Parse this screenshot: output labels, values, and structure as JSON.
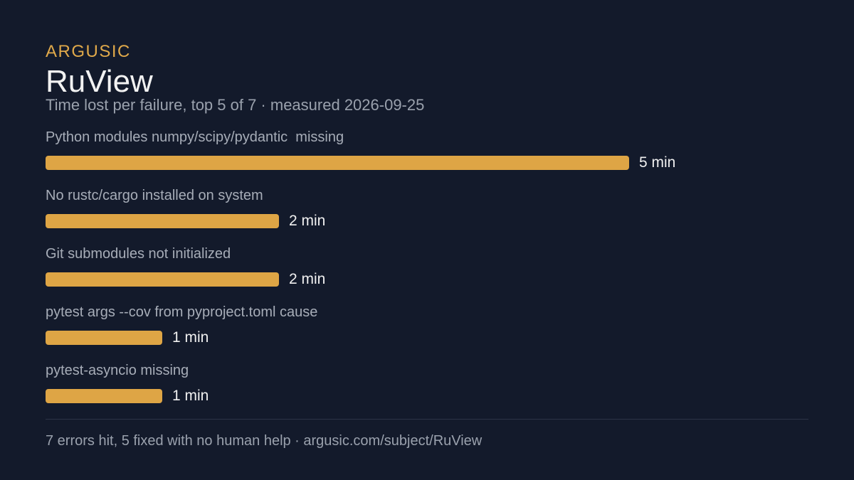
{
  "brand": "ARGUSIC",
  "title": "RuView",
  "subtitle": "Time lost per failure, top 5 of 7 · measured 2026-09-25",
  "footer": "7 errors hit, 5 fixed with no human help · argusic.com/subject/RuView",
  "colors": {
    "background": "#131a2b",
    "accent": "#e0a94a",
    "bar": "#dea545"
  },
  "chart_data": {
    "type": "bar",
    "orientation": "horizontal",
    "categories": [
      "Python modules numpy/scipy/pydantic  missing",
      "No rustc/cargo installed on system",
      "Git submodules not initialized",
      "pytest args --cov from pyproject.toml cause",
      "pytest-asyncio missing"
    ],
    "values": [
      5,
      2,
      2,
      1,
      1
    ],
    "value_labels": [
      "5 min",
      "2 min",
      "2 min",
      "1 min",
      "1 min"
    ],
    "unit": "min",
    "xlim": [
      0,
      5
    ]
  }
}
